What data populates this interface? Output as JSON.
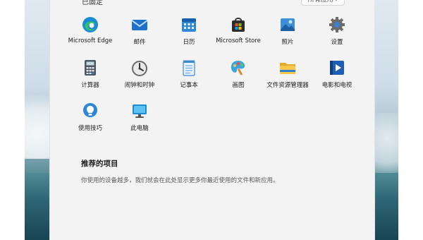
{
  "header": {
    "cutoff_label": "已固定",
    "button_label": "所有应用 ›"
  },
  "pinned": [
    {
      "label": "Microsoft Edge",
      "icon": "edge-icon"
    },
    {
      "label": "邮件",
      "icon": "mail-icon"
    },
    {
      "label": "日历",
      "icon": "calendar-icon"
    },
    {
      "label": "Microsoft Store",
      "icon": "store-icon"
    },
    {
      "label": "照片",
      "icon": "photos-icon"
    },
    {
      "label": "设置",
      "icon": "settings-icon"
    },
    {
      "label": "计算器",
      "icon": "calculator-icon"
    },
    {
      "label": "闹钟和时钟",
      "icon": "clock-icon"
    },
    {
      "label": "记事本",
      "icon": "notepad-icon"
    },
    {
      "label": "画图",
      "icon": "paint-icon"
    },
    {
      "label": "文件资源管理器",
      "icon": "file-explorer-icon"
    },
    {
      "label": "电影和电视",
      "icon": "movies-tv-icon"
    },
    {
      "label": "使用技巧",
      "icon": "tips-icon"
    },
    {
      "label": "此电脑",
      "icon": "this-pc-icon"
    }
  ],
  "recommended": {
    "title": "推荐的项目",
    "description": "你使用的设备越多，我们就会在此处显示更多你最近使用的文件和新应用。"
  }
}
